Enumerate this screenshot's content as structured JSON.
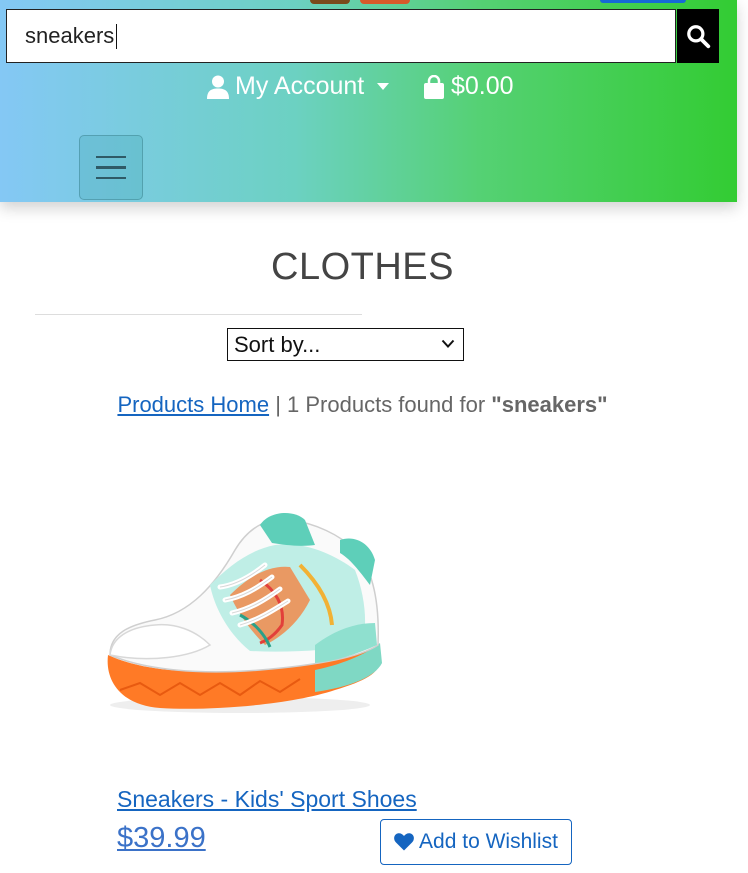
{
  "header": {
    "search": {
      "value": "sneakers",
      "placeholder": "sneakers",
      "button_icon": "search-icon"
    },
    "account": {
      "label": "My Account",
      "icon": "user-icon"
    },
    "cart": {
      "total": "$0.00",
      "icon": "shopping-bag-icon"
    },
    "menu_icon": "hamburger-icon",
    "colors": {
      "gradient_start": "#84c8f5",
      "gradient_end": "#33cc33"
    }
  },
  "main": {
    "title": "CLOTHES",
    "sort": {
      "selected": "Sort by..."
    },
    "results": {
      "home_link": "Products Home",
      "separator": "|",
      "count_text": "1 Products found for",
      "query": "\"sneakers\""
    },
    "products": [
      {
        "name": "Sneakers - Kids' Sport Shoes",
        "price": "$39.99",
        "wishlist_label": "Add to Wishlist",
        "wishlist_icon": "heart-icon"
      }
    ]
  },
  "colors": {
    "link": "#1565c0",
    "price": "#3b72c8"
  }
}
